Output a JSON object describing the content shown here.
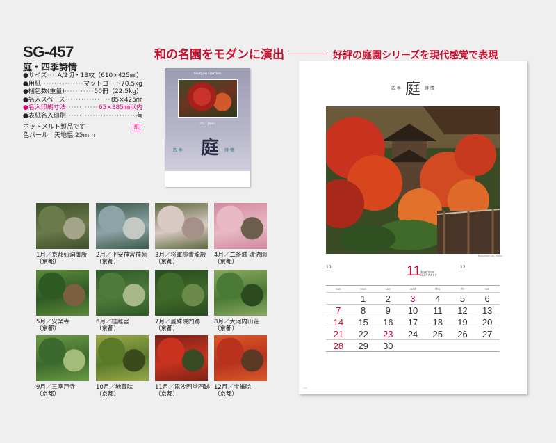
{
  "header": {
    "code": "SG-457",
    "name": "庭・四季詩情",
    "tagline_main": "和の名園をモダンに演出",
    "tagline_sub": "好評の庭園シリーズを現代感覚で表現"
  },
  "specs": [
    {
      "label": "●サイズ",
      "value": "A/2切・13枚（610×425㎜）",
      "highlight": false
    },
    {
      "label": "●用紙",
      "value": "マットコート70.5kg",
      "highlight": false
    },
    {
      "label": "●梱包数(重量)",
      "value": "50冊（22.5kg）",
      "highlight": false
    },
    {
      "label": "●名入スペース",
      "value": "85×425㎜",
      "highlight": false
    },
    {
      "label": "●名入印刷寸法",
      "value": "65×385㎜以内",
      "highlight": true
    },
    {
      "label": "●表紙名入印刷",
      "value": "有",
      "highlight": false
    }
  ],
  "notes": {
    "line1": "ホットメルト製品です",
    "line2": "色パール　天地幅:25mm",
    "mark": "紙"
  },
  "cover": {
    "title": "Shinjou Garden",
    "year": "2027 Japan",
    "kanji": "庭",
    "left_text": "四  季",
    "right_text": "詩  情"
  },
  "thumbnails": [
    {
      "month": "1月／京都仙洞御所",
      "place": "（京都）",
      "colors": [
        "#6b7a4a",
        "#3d4f2c",
        "#a3a48a"
      ]
    },
    {
      "month": "2月／平安神宮神苑",
      "place": "（京都）",
      "colors": [
        "#8ea3a8",
        "#3c5a48",
        "#c4c9c4"
      ]
    },
    {
      "month": "3月／将軍塚青龍殿",
      "place": "（京都）",
      "colors": [
        "#d9c9c4",
        "#5e6a3f",
        "#a69088"
      ]
    },
    {
      "month": "4月／二条城 清流園",
      "place": "（京都）",
      "colors": [
        "#e8b8c4",
        "#d28aa0",
        "#6b5e4a"
      ]
    },
    {
      "month": "5月／安楽寺",
      "place": "（京都）",
      "colors": [
        "#2f5a24",
        "#5d8a3a",
        "#7a6040"
      ]
    },
    {
      "month": "6月／桂離宮",
      "place": "（京都）",
      "colors": [
        "#4f7a3a",
        "#2f5a2a",
        "#a8b88a"
      ]
    },
    {
      "month": "7月／曼殊院門跡",
      "place": "（京都）",
      "colors": [
        "#3f6a2a",
        "#2a4a1f",
        "#6b8a4a"
      ]
    },
    {
      "month": "8月／大河内山荘",
      "place": "（京都）",
      "colors": [
        "#4a7a34",
        "#8aa860",
        "#2c4a20"
      ]
    },
    {
      "month": "9月／三室戸寺",
      "place": "（京都）",
      "colors": [
        "#3c6a2e",
        "#6a9a44",
        "#a3bc7a"
      ]
    },
    {
      "month": "10月／地蔵院",
      "place": "（京都）",
      "colors": [
        "#5a7a2a",
        "#9aa84a",
        "#3a4a1c"
      ]
    },
    {
      "month": "11月／毘沙門堂門跡",
      "place": "（京都）",
      "colors": [
        "#c8321e",
        "#7a2418",
        "#3a4a24"
      ]
    },
    {
      "month": "12月／宝厳院",
      "place": "（京都）",
      "colors": [
        "#b8321e",
        "#d85a2a",
        "#5a3a24"
      ]
    }
  ],
  "calendar": {
    "header_left": "四  季",
    "header_kanji": "庭",
    "header_right": "詩  情",
    "credit": "Bishamon-do, Kyoto",
    "month": "11",
    "month_en": "November",
    "year_label": "2027 ####",
    "prev_month": "10",
    "next_month": "12",
    "dow": [
      "sun",
      "mon",
      "tue",
      "wed",
      "thu",
      "fri",
      "sat"
    ],
    "weeks": [
      [
        "",
        "1",
        "2",
        "3",
        "4",
        "5",
        "6"
      ],
      [
        "7",
        "8",
        "9",
        "10",
        "11",
        "12",
        "13"
      ],
      [
        "14",
        "15",
        "16",
        "17",
        "18",
        "19",
        "20"
      ],
      [
        "21",
        "22",
        "23",
        "24",
        "25",
        "26",
        "27"
      ],
      [
        "28",
        "29",
        "30",
        "",
        "",
        "",
        ""
      ]
    ],
    "holidays": [
      "3",
      "23"
    ],
    "page_no": "•19"
  },
  "colors": {
    "accent": "#c8102e",
    "pink": "#e0007a"
  }
}
